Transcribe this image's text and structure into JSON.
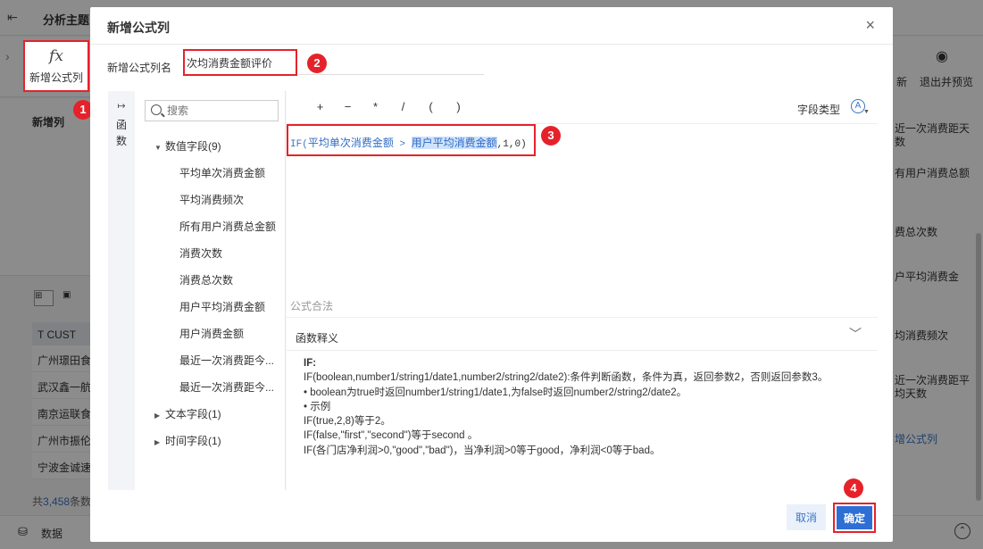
{
  "background": {
    "exit_icon": "exit-icon",
    "theme_title": "分析主题",
    "toolbar_new_col": "新增公式列",
    "fx_glyph": "fx",
    "left_section": "新增列",
    "table_header": "CUST",
    "table_rows": [
      "广州璟田食",
      "武汉鑫一航",
      "南京运联食",
      "广州市振伦",
      "宁波金诚速"
    ],
    "count_prefix": "共",
    "count_value": "3,458",
    "count_suffix": "条数",
    "bottom_data": "数据",
    "right_new": "新",
    "right_exit": "退出并预览",
    "right_fields": [
      "近一次消费距天数",
      "有用户消费总额",
      "费总次数",
      "户平均消费金",
      "均消费频次",
      "近一次消费距平均天数",
      "增公式列"
    ]
  },
  "dialog": {
    "title": "新增公式列",
    "close": "×",
    "name_label": "新增公式列名",
    "name_value": "次均消费金额评价",
    "fn_tab_label": "函数",
    "search_placeholder": "搜索",
    "tree": {
      "numeric_label": "数值字段(9)",
      "numeric_items": [
        "平均单次消费金额",
        "平均消费频次",
        "所有用户消费总金额",
        "消费次数",
        "消费总次数",
        "用户平均消费金额",
        "用户消费金额",
        "最近一次消费距今...",
        "最近一次消费距今..."
      ],
      "text_label": "文本字段(1)",
      "time_label": "时间字段(1)"
    },
    "operators": [
      "+",
      "−",
      "*",
      "/",
      "(",
      ")"
    ],
    "field_type_label": "字段类型",
    "formula": {
      "fn": "IF",
      "open": "(",
      "field1": "平均单次消费金额",
      "gt": ">",
      "field2": "用户平均消费金额",
      "tail": ",1,0)"
    },
    "status": "公式合法",
    "fn_explain": {
      "header": "函数释义",
      "title": "IF:",
      "lines": [
        "IF(boolean,number1/string1/date1,number2/string2/date2):条件判断函数，条件为真，返回参数2，否则返回参数3。",
        "• boolean为true时返回number1/string1/date1,为false时返回number2/string2/date2。",
        "• 示例",
        "IF(true,2,8)等于2。",
        "IF(false,\"first\",\"second\")等于second 。",
        "IF(各门店净利润>0,\"good\",\"bad\")，当净利润>0等于good，净利润<0等于bad。"
      ]
    },
    "cancel": "取消",
    "ok": "确定"
  },
  "badges": [
    "1",
    "2",
    "3",
    "4"
  ],
  "colors": {
    "accent": "#2e6fd6",
    "highlight_red": "#e5222a",
    "link_blue": "#3a75c4"
  }
}
